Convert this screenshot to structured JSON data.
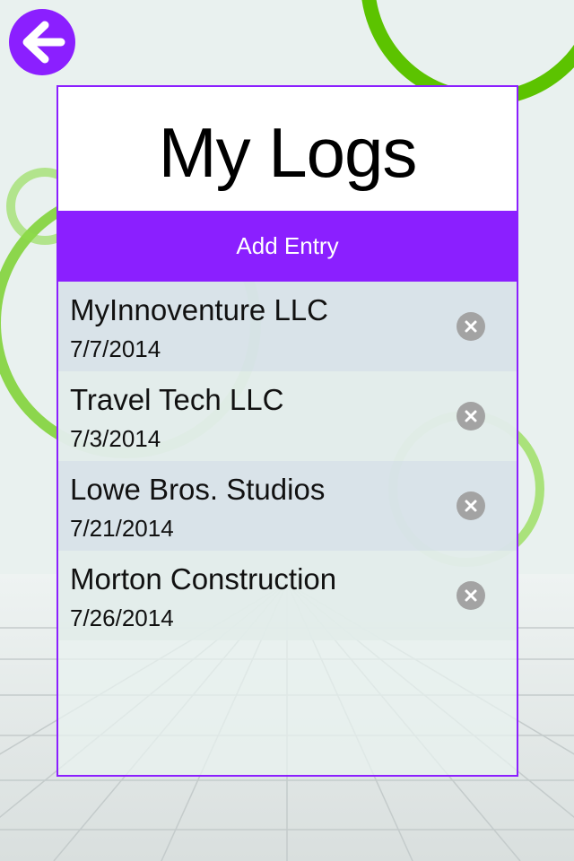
{
  "header": {
    "back_icon": "arrow-left-icon",
    "title": "My Logs",
    "add_entry_label": "Add Entry"
  },
  "entries": [
    {
      "name": "MyInnoventure LLC",
      "date": "7/7/2014",
      "delete_icon": "close-circle-icon"
    },
    {
      "name": "Travel Tech LLC",
      "date": "7/3/2014",
      "delete_icon": "close-circle-icon"
    },
    {
      "name": "Lowe Bros. Studios",
      "date": "7/21/2014",
      "delete_icon": "close-circle-icon"
    },
    {
      "name": "Morton Construction",
      "date": "7/26/2014",
      "delete_icon": "close-circle-icon"
    }
  ],
  "colors": {
    "accent": "#8b1fff",
    "ring_green": "#5cc300",
    "background": "#e9f1ef"
  }
}
